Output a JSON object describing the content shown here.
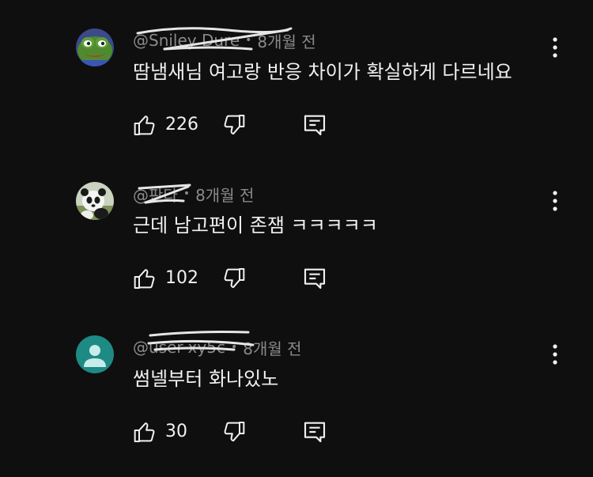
{
  "comments": [
    {
      "handle": "@Sniley Dure",
      "time": "8개월 전",
      "text": "땀냄새님 여고랑 반응 차이가 확실하게 다르네요",
      "likes": "226",
      "avatar": "frog-avatar"
    },
    {
      "handle": "@판다",
      "time": "8개월 전",
      "text": "근데 남고편이 존잼 ㅋㅋㅋㅋㅋ",
      "likes": "102",
      "avatar": "panda-avatar"
    },
    {
      "handle": "@user-xy5c",
      "time": "8개월 전",
      "text": "썸넬부터 화나있노",
      "likes": "30",
      "avatar": "default-avatar"
    }
  ],
  "colors": {
    "background": "#0f0f0f",
    "text": "#f1f1f1",
    "muted": "#8a8a8a",
    "default_avatar": "#1e8a84"
  },
  "icons": [
    "thumbs-up-icon",
    "thumbs-down-icon",
    "reply-icon",
    "more-vert-icon"
  ]
}
